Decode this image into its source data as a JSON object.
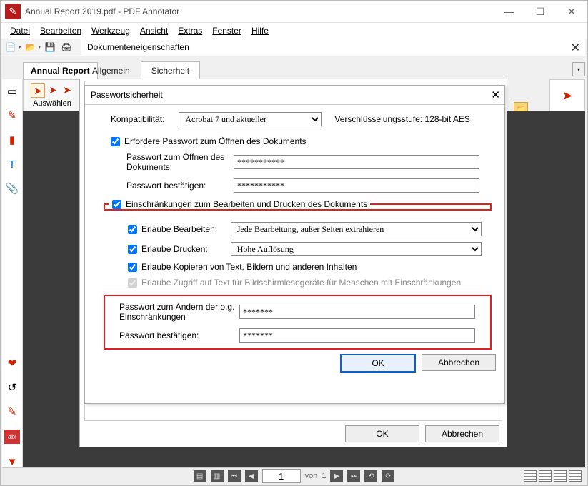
{
  "window": {
    "title": "Annual Report 2019.pdf - PDF Annotator"
  },
  "menu": {
    "file": "Datei",
    "edit": "Bearbeiten",
    "tool": "Werkzeug",
    "view": "Ansicht",
    "extras": "Extras",
    "window": "Fenster",
    "help": "Hilfe"
  },
  "docprops": {
    "title": "Dokumenteneigenschaften"
  },
  "maintab": {
    "label": "Annual Report"
  },
  "subtabs": {
    "general": "Allgemein",
    "security": "Sicherheit"
  },
  "selectbar": {
    "label": "Auswählen"
  },
  "dlg2": {
    "title": "Passwortsicherheit",
    "compat_label": "Kompatibilität:",
    "compat_value": "Acrobat 7 und aktueller",
    "enc_label": "Verschlüsselungsstufe:",
    "enc_value": "128-bit AES",
    "require_open": "Erfordere Passwort zum Öffnen des Dokuments",
    "open_pwd_label": "Passwort zum Öffnen des Dokuments:",
    "open_pwd_value": "***********",
    "open_confirm_label": "Passwort bestätigen:",
    "open_confirm_value": "***********",
    "restrict_legend": "Einschränkungen zum Bearbeiten und Drucken des Dokuments",
    "allow_edit_label": "Erlaube Bearbeiten:",
    "allow_edit_value": "Jede  Bearbeitung, außer Seiten extrahieren",
    "allow_print_label": "Erlaube Drucken:",
    "allow_print_value": "Hohe Auflösung",
    "allow_copy": "Erlaube Kopieren von Text, Bildern und anderen Inhalten",
    "allow_reader": "Erlaube Zugriff auf Text für Bildschirmlesegeräte für Menschen mit Einschränkungen",
    "perm_pwd_label": "Passwort zum Ändern der o.g. Einschränkungen",
    "perm_pwd_value": "*******",
    "perm_confirm_label": "Passwort bestätigen:",
    "perm_confirm_value": "*******",
    "ok": "OK",
    "cancel": "Abbrechen"
  },
  "dlg1": {
    "ok": "OK",
    "cancel": "Abbrechen"
  },
  "status": {
    "page_current": "1",
    "page_sep": "von",
    "page_total": "1"
  }
}
